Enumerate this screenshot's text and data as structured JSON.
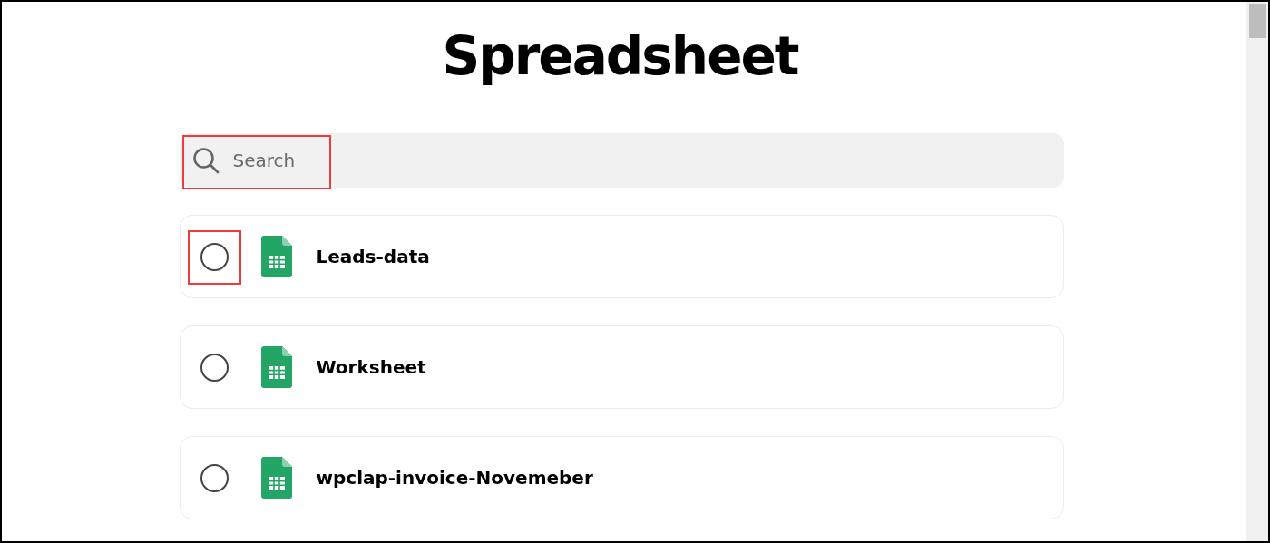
{
  "title": "Spreadsheet",
  "search": {
    "placeholder": "Search",
    "highlighted": true
  },
  "files": [
    {
      "name": "Leads-data",
      "selected": false,
      "highlighted": true
    },
    {
      "name": "Worksheet",
      "selected": false,
      "highlighted": false
    },
    {
      "name": "wpclap-invoice-Novemeber",
      "selected": false,
      "highlighted": false
    }
  ]
}
